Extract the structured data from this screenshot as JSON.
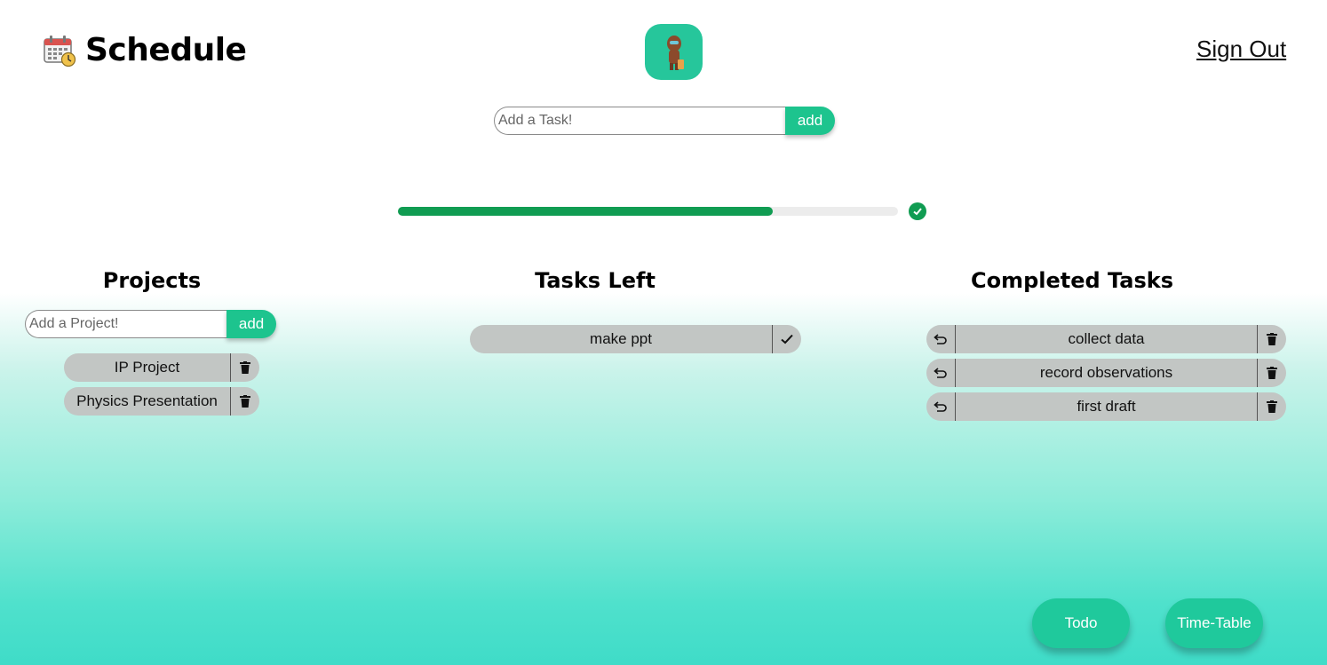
{
  "header": {
    "title": "Schedule",
    "signout_label": "Sign Out"
  },
  "task_form": {
    "placeholder": "Add a Task!",
    "add_label": "add"
  },
  "progress": {
    "completed_fraction": 0.75
  },
  "projects": {
    "heading": "Projects",
    "placeholder": "Add a Project!",
    "add_label": "add",
    "items": [
      {
        "label": "IP Project"
      },
      {
        "label": "Physics Presentation"
      }
    ]
  },
  "tasks_left": {
    "heading": "Tasks Left",
    "items": [
      {
        "label": "make ppt"
      }
    ]
  },
  "completed": {
    "heading": "Completed Tasks",
    "items": [
      {
        "label": "collect data"
      },
      {
        "label": "record observations"
      },
      {
        "label": "first draft"
      }
    ]
  },
  "footer": {
    "todo_label": "Todo",
    "timetable_label": "Time-Table"
  },
  "colors": {
    "accent": "#1dc48e",
    "progress": "#109c52",
    "pill": "#c2c6c4"
  }
}
